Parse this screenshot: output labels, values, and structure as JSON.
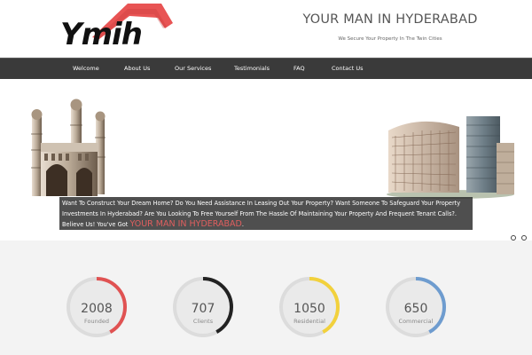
{
  "header": {
    "logo_text": "Ymih",
    "title": "YOUR MAN IN HYDERABAD",
    "tagline": "We Secure Your Property In The Twin Cities"
  },
  "nav": {
    "items": [
      {
        "label": "Welcome"
      },
      {
        "label": "About Us"
      },
      {
        "label": "Our Services"
      },
      {
        "label": "Testimonials"
      },
      {
        "label": "FAQ"
      },
      {
        "label": "Contact Us"
      }
    ]
  },
  "slider": {
    "caption_text": "Want To Construct Your Dream Home? Do You Need Assistance In Leasing Out Your Property? Want Someone To Safeguard Your Property Investments In Hyderabad? Are You Looking To Free Yourself From The Hassle Of Maintaining Your Property And Frequent Tenant Calls?. Believe Us! You've Got",
    "caption_highlight": "YOUR MAN IN HYDERABAD",
    "caption_end": "."
  },
  "stats": [
    {
      "number": "2008",
      "label": "Founded",
      "color": "#e05252",
      "fraction": 0.42
    },
    {
      "number": "707",
      "label": "Clients",
      "color": "#222222",
      "fraction": 0.42
    },
    {
      "number": "1050",
      "label": "Residential",
      "color": "#f2d13c",
      "fraction": 0.42
    },
    {
      "number": "650",
      "label": "Commercial",
      "color": "#6e9ccf",
      "fraction": 0.42
    }
  ],
  "colors": {
    "roof": "#e85454",
    "navbar": "#3a3a3a",
    "highlight": "#e05f5f"
  }
}
